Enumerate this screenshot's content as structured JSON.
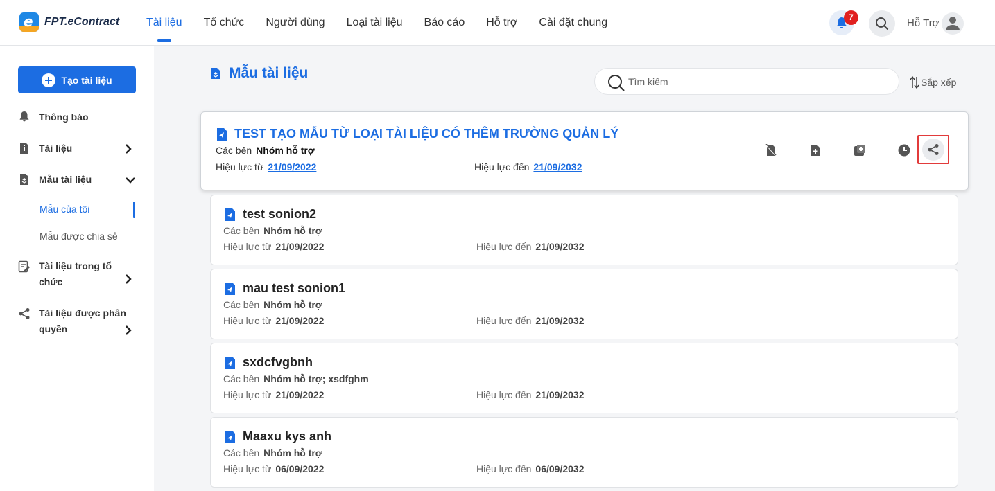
{
  "brand": {
    "name": "FPT.eContract",
    "logo_glyph": "e"
  },
  "nav": {
    "items": [
      {
        "label": "Tài liệu",
        "active": true
      },
      {
        "label": "Tổ chức"
      },
      {
        "label": "Người dùng"
      },
      {
        "label": "Loại tài liệu"
      },
      {
        "label": "Báo cáo"
      },
      {
        "label": "Hỗ trợ"
      },
      {
        "label": "Cài đặt chung"
      }
    ],
    "notification_count": "7",
    "user_name": "Hỗ Trợ"
  },
  "sidebar": {
    "create_label": "Tạo tài liệu",
    "items": [
      {
        "label": "Thông báo",
        "icon": "bell-icon"
      },
      {
        "label": "Tài liệu",
        "icon": "document-icon"
      },
      {
        "label": "Mẫu tài liệu",
        "icon": "template-icon"
      }
    ],
    "sub_items": [
      {
        "label": "Mẫu của tôi",
        "active": true
      },
      {
        "label": "Mẫu được chia sẻ"
      }
    ],
    "org_docs_label": "Tài liệu trong tổ chức",
    "shared_docs_label": "Tài liệu được phân quyền"
  },
  "main": {
    "title": "Mẫu tài liệu",
    "search_placeholder": "Tìm kiếm",
    "sort_label": "Sắp xếp",
    "parties_label": "Các bên",
    "valid_from_label": "Hiệu lực từ",
    "valid_to_label": "Hiệu lực đến",
    "templates": [
      {
        "title": "TEST TẠO MẪU TỪ LOẠI TÀI LIỆU CÓ THÊM TRƯỜNG QUẢN LÝ",
        "parties": "Nhóm hỗ trợ",
        "from": "21/09/2022",
        "to": "21/09/2032"
      },
      {
        "title": "test sonion2",
        "parties": "Nhóm hỗ trợ",
        "from": "21/09/2022",
        "to": "21/09/2032"
      },
      {
        "title": "mau test sonion1",
        "parties": "Nhóm hỗ trợ",
        "from": "21/09/2022",
        "to": "21/09/2032"
      },
      {
        "title": "sxdcfvgbnh",
        "parties": "Nhóm hỗ trợ; xsdfghm",
        "from": "21/09/2022",
        "to": "21/09/2032"
      },
      {
        "title": "Maaxu kys anh",
        "parties": "Nhóm hỗ trợ",
        "from": "06/09/2022",
        "to": "06/09/2032"
      }
    ]
  },
  "colors": {
    "accent": "#1c6de2",
    "highlight": "#e23b3b",
    "badge": "#e02020"
  }
}
